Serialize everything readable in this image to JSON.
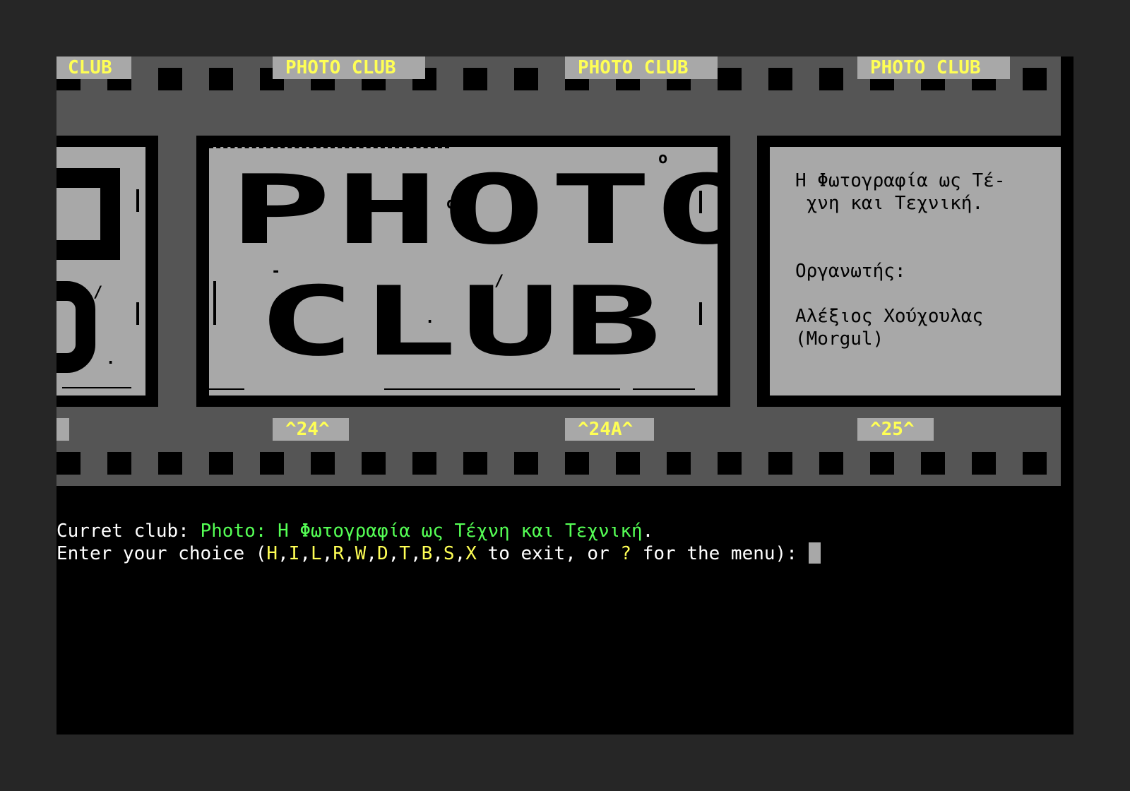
{
  "tags_top": [
    "CLUB",
    "PHOTO CLUB",
    "PHOTO CLUB",
    "PHOTO CLUB"
  ],
  "tags_bottom": [
    "^24^",
    "^24A^",
    "^25^"
  ],
  "banner": {
    "line1": "PHOTO",
    "line2": "CLUB"
  },
  "info": {
    "line1": "Η Φωτογραφία ως Τέ-",
    "line2": " χνη και Τεχνική.",
    "organizer_label": "Οργανωτής:",
    "organizer_name": "Αλέξιος Χούχουλας",
    "organizer_alias": "(Morgul)"
  },
  "terminal": {
    "club_label": "Curret club: ",
    "club_value": "Photo: Η Φωτογραφία ως Τέχνη και Τεχνική",
    "club_end": ".",
    "prompt_start": "Enter your choice (",
    "keys": [
      "H",
      "I",
      "L",
      "R",
      "W",
      "D",
      "T",
      "B",
      "S",
      "X"
    ],
    "prompt_exit": " to exit, or ",
    "help_key": "?",
    "prompt_end": " for the menu): "
  },
  "colors": {
    "film": "#555555",
    "frame_bg": "#a8a8a8",
    "accent_yellow": "#ffff55",
    "accent_green": "#55ff55",
    "text_white": "#ffffff"
  }
}
